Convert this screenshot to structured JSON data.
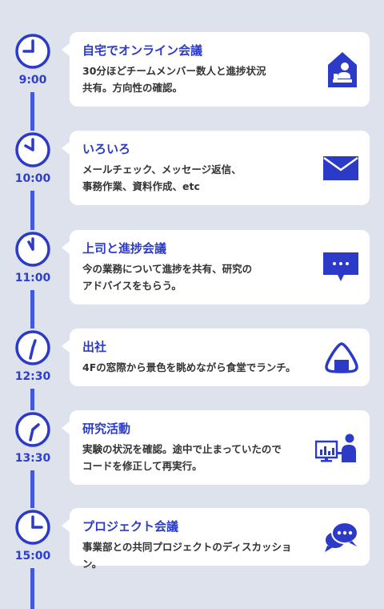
{
  "theme": {
    "accent": "#2b3bc8",
    "line": "#4257e6",
    "background": "#dde2ec",
    "card": "#ffffff"
  },
  "schedule": [
    {
      "time": "9:00",
      "title": "自宅でオンライン会議",
      "desc": "30分ほどチームメンバー数人と進捗状況\n共有。方向性の確認。",
      "icon": "home-work-icon"
    },
    {
      "time": "10:00",
      "title": "いろいろ",
      "desc": "メールチェック、メッセージ返信、\n事務作業、資料作成、etc",
      "icon": "mail-icon"
    },
    {
      "time": "11:00",
      "title": "上司と進捗会議",
      "desc": "今の業務について進捗を共有、研究の\nアドバイスをもらう。",
      "icon": "chat-bubble-icon"
    },
    {
      "time": "12:30",
      "title": "出社",
      "desc": "4Fの窓際から景色を眺めながら食堂でランチ。",
      "icon": "onigiri-icon"
    },
    {
      "time": "13:30",
      "title": "研究活動",
      "desc": "実験の状況を確認。途中で止まっていたので\nコードを修正して再実行。",
      "icon": "desk-monitor-icon"
    },
    {
      "time": "15:00",
      "title": "プロジェクト会議",
      "desc": "事業部との共同プロジェクトのディスカッション。",
      "icon": "chat-bubbles-icon"
    }
  ]
}
